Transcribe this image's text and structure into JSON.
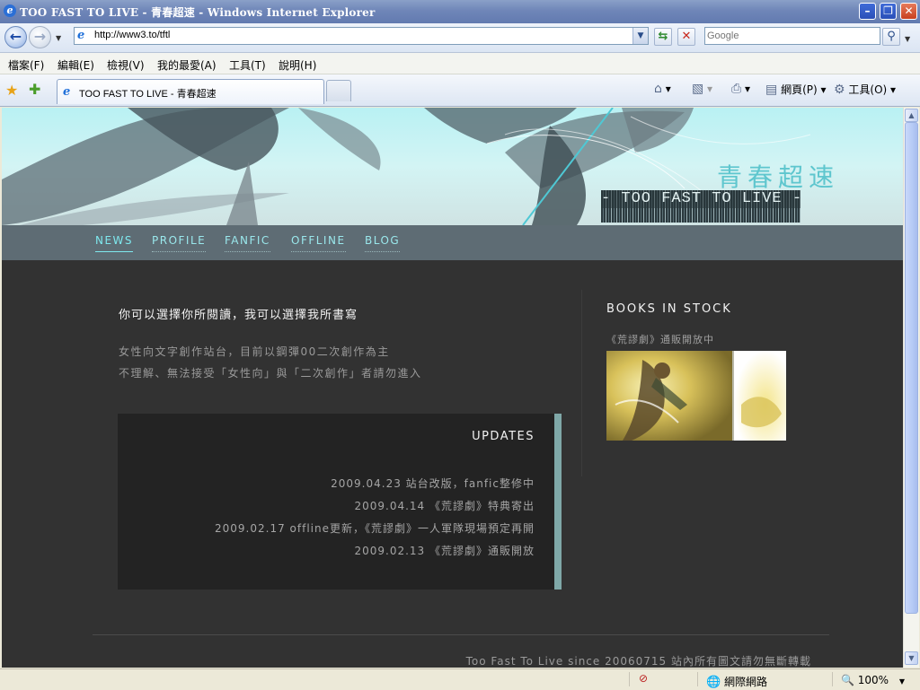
{
  "window": {
    "title": "TOO FAST TO LIVE - 青春超速 - Windows Internet Explorer"
  },
  "addressbar": {
    "url": "http://www3.to/tftl",
    "search_placeholder": "Google"
  },
  "menu": [
    "檔案(F)",
    "編輯(E)",
    "檢視(V)",
    "我的最愛(A)",
    "工具(T)",
    "說明(H)"
  ],
  "tab": {
    "label": "TOO FAST TO LIVE - 青春超速"
  },
  "commandbar": {
    "page_label": "網頁(P)",
    "tools_label": "工具(O)"
  },
  "site": {
    "brand_cn": "青春超速",
    "brand_en": "- TOO FAST TO LIVE -",
    "nav": [
      "NEWS",
      "PROFILE",
      "FANFIC",
      "OFFLINE",
      "BLOG"
    ],
    "tagline": "你可以選擇你所閱讀，我可以選擇我所書寫",
    "intro": [
      "女性向文字創作站台，目前以鋼彈00二次創作為主",
      "不理解、無法接受「女性向」與「二次創作」者請勿進入"
    ],
    "updates": {
      "heading": "UPDATES",
      "items": [
        "2009.04.23 站台改版，fanfic整修中",
        "2009.04.14 《荒謬劇》特典寄出",
        "2009.02.17 offline更新，《荒謬劇》一人軍隊現場預定再開",
        "2009.02.13 《荒謬劇》通販開放"
      ]
    },
    "sidebar": {
      "heading": "BOOKS IN STOCK",
      "subheading": "《荒謬劇》通販開放中"
    },
    "footer": "Too Fast To Live since 20060715 站內所有圖文請勿無斷轉載"
  },
  "statusbar": {
    "zone": "網際網路",
    "zoom": "100%"
  }
}
